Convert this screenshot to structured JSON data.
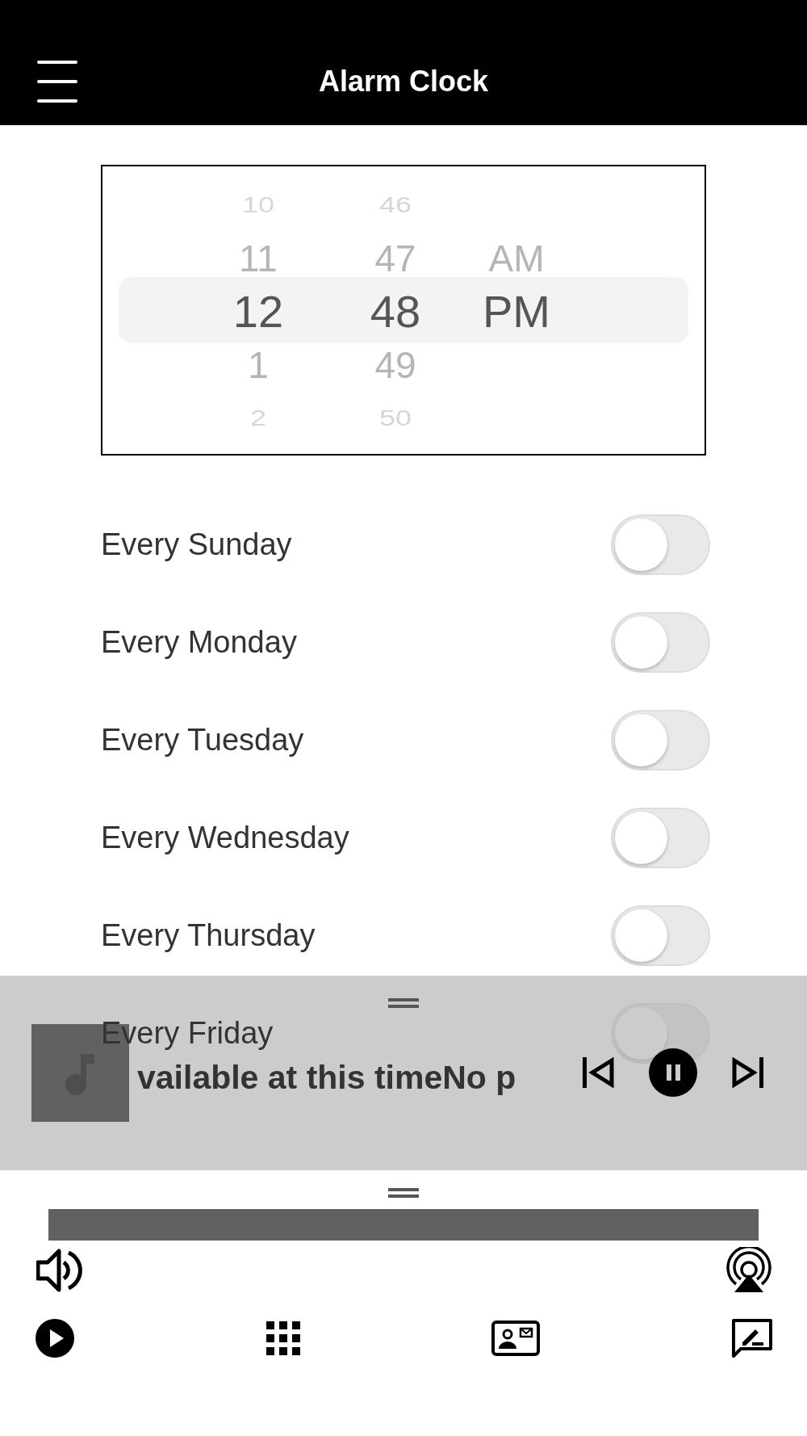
{
  "header": {
    "title": "Alarm Clock"
  },
  "picker": {
    "columns": [
      {
        "kind": "hour",
        "items": [
          {
            "value": "10",
            "selected": false
          },
          {
            "value": "11",
            "selected": false
          },
          {
            "value": "12",
            "selected": true
          },
          {
            "value": "1",
            "selected": false
          },
          {
            "value": "2",
            "selected": false
          }
        ]
      },
      {
        "kind": "minute",
        "items": [
          {
            "value": "46",
            "selected": false
          },
          {
            "value": "47",
            "selected": false
          },
          {
            "value": "48",
            "selected": true
          },
          {
            "value": "49",
            "selected": false
          },
          {
            "value": "50",
            "selected": false
          }
        ]
      },
      {
        "kind": "period",
        "items": [
          {
            "value": "AM",
            "selected": false
          },
          {
            "value": "PM",
            "selected": true
          }
        ]
      }
    ]
  },
  "repeat_days": [
    {
      "label": "Every Sunday",
      "on": false
    },
    {
      "label": "Every Monday",
      "on": false
    },
    {
      "label": "Every Tuesday",
      "on": false
    },
    {
      "label": "Every Wednesday",
      "on": false
    },
    {
      "label": "Every Thursday",
      "on": false
    },
    {
      "label": "Every Friday",
      "on": false
    }
  ],
  "mini_player": {
    "title": "vailable at this timeNo p",
    "playing": true
  }
}
